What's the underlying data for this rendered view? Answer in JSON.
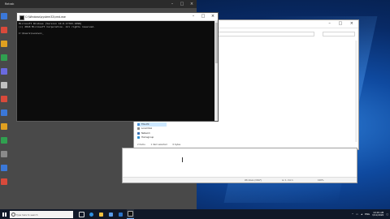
{
  "colors": {
    "desktop_blue": "#0f4aa0",
    "taskbar": "#101828",
    "cmd_background": "#0c0c0c",
    "cmd_text": "#cccccc",
    "selection_blue": "#cde8ff"
  },
  "background_app": {
    "title": "Retrak",
    "min": "–",
    "max": "□",
    "close": "×"
  },
  "cmd_window": {
    "title": "C:\\Windows\\system32\\cmd.exe",
    "minimize": "–",
    "maximize": "□",
    "close": "×",
    "lines": [
      "Microsoft Windows [Version 10.0.17763.1098]",
      "(c) 2018 Microsoft Corporation. All rights reserved.",
      "",
      "C:\\Users\\Lenovo>_"
    ]
  },
  "explorer_window": {
    "controls": "–  □  ×",
    "nav_items": [
      {
        "label": "OneDrive",
        "icon": "onedrive-icon"
      },
      {
        "label": "This PC",
        "icon": "pc-icon"
      },
      {
        "label": "Local Disk",
        "icon": "disk-icon"
      },
      {
        "label": "Network",
        "icon": "network-icon"
      },
      {
        "label": "Homegroup",
        "icon": "homegroup-icon"
      }
    ],
    "status_items": [
      "2 items",
      "1 item selected",
      "0 bytes"
    ]
  },
  "second_window": {
    "status": [
      "Windows (CRLF)",
      "Ln 1, Col 1",
      "100%"
    ]
  },
  "taskbar": {
    "search_placeholder": "Type here to search",
    "time": "10:29 AM",
    "date": "3/11/2020",
    "tray_text": "ENG"
  }
}
